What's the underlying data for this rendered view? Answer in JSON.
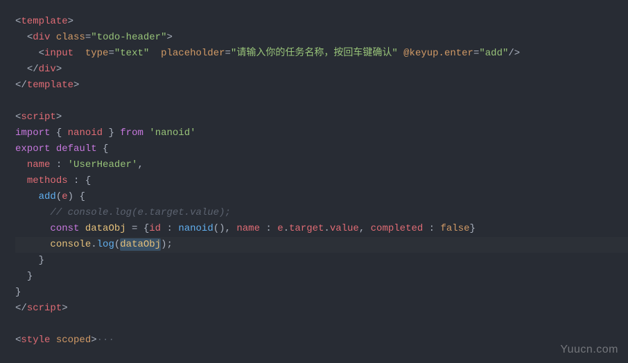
{
  "code": {
    "l1_open": "<",
    "l1_tag": "template",
    "l1_close": ">",
    "l2_open": "<",
    "l2_tag": "div",
    "l2_attr": "class",
    "l2_eq": "=",
    "l2_val": "\"todo-header\"",
    "l2_close": ">",
    "l3_open": "<",
    "l3_tag": "input",
    "l3_attr1": "type",
    "l3_eq1": "=",
    "l3_val1": "\"text\"",
    "l3_attr2": "placeholder",
    "l3_eq2": "=",
    "l3_val2": "\"请输入你的任务名称，按回车键确认\"",
    "l3_attr3": "@keyup.enter",
    "l3_eq3": "=",
    "l3_val3": "\"add\"",
    "l3_close": "/>",
    "l4_open": "</",
    "l4_tag": "div",
    "l4_close": ">",
    "l5_open": "</",
    "l5_tag": "template",
    "l5_close": ">",
    "l7_open": "<",
    "l7_tag": "script",
    "l7_close": ">",
    "l8_import": "import",
    "l8_brace1": " { ",
    "l8_nanoid": "nanoid",
    "l8_brace2": " } ",
    "l8_from": "from",
    "l8_str": "'nanoid'",
    "l9_export": "export",
    "l9_default": "default",
    "l9_brace": " {",
    "l10_name": "name",
    "l10_colon": " : ",
    "l10_val": "'UserHeader'",
    "l10_comma": ",",
    "l11_methods": "methods",
    "l11_colon": " : ",
    "l11_brace": "{",
    "l12_add": "add",
    "l12_paren1": "(",
    "l12_e": "e",
    "l12_paren2": ")",
    "l12_brace": " {",
    "l13_comment": "// console.log(e.target.value);",
    "l14_const": "const",
    "l14_var": "dataObj",
    "l14_eq": " = ",
    "l14_brace1": "{",
    "l14_id": "id",
    "l14_colon1": " : ",
    "l14_nanoid": "nanoid",
    "l14_paren": "()",
    "l14_comma1": ", ",
    "l14_name": "name",
    "l14_colon2": " : ",
    "l14_e": "e",
    "l14_dot1": ".",
    "l14_target": "target",
    "l14_dot2": ".",
    "l14_value": "value",
    "l14_comma2": ", ",
    "l14_completed": "completed",
    "l14_colon3": " : ",
    "l14_false": "false",
    "l14_brace2": "}",
    "l15_console": "console",
    "l15_dot": ".",
    "l15_log": "log",
    "l15_paren1": "(",
    "l15_arg": "dataObj",
    "l15_paren2": ")",
    "l15_semi": ";",
    "l16_brace": "}",
    "l17_brace": "}",
    "l18_brace": "}",
    "l19_open": "</",
    "l19_tag": "script",
    "l19_close": ">",
    "l21_open": "<",
    "l21_tag": "style",
    "l21_attr": "scoped",
    "l21_close": ">",
    "l21_dots": "···"
  },
  "watermark": "Yuucn.com"
}
